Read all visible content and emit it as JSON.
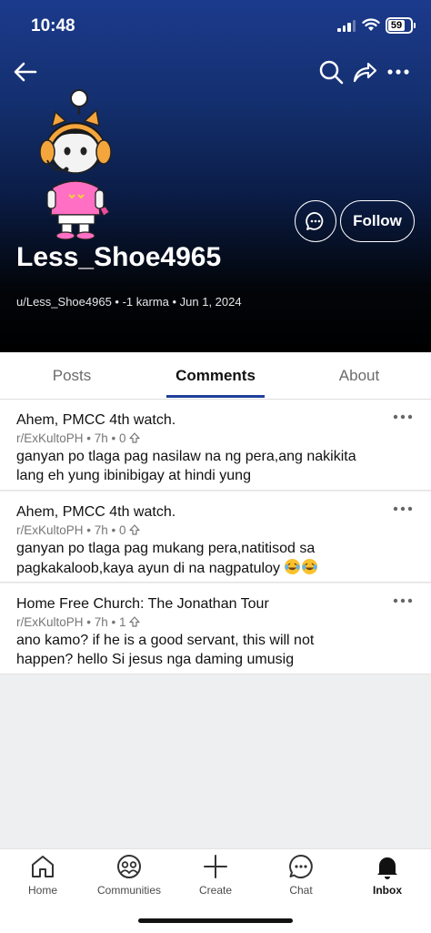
{
  "status": {
    "time": "10:48",
    "battery": "59"
  },
  "icons": {
    "back": "arrow-left-icon",
    "search": "search-icon",
    "share": "share-icon",
    "more": "more-horizontal-icon",
    "chat": "chat-bubble-icon",
    "avatar": "snoo-avatar"
  },
  "profile": {
    "username": "Less_Shoe4965",
    "meta": "u/Less_Shoe4965 • -1 karma • Jun 1, 2024",
    "follow_label": "Follow"
  },
  "tabs": [
    {
      "label": "Posts"
    },
    {
      "label": "Comments"
    },
    {
      "label": "About"
    }
  ],
  "comments": [
    {
      "title": "Ahem, PMCC 4th watch.",
      "meta": "r/ExKultoPH • 7h • 0",
      "body": "ganyan po tlaga pag nasilaw na ng pera,ang nakikita lang eh yung ibinibigay at hindi yung"
    },
    {
      "title": "Ahem, PMCC 4th watch.",
      "meta": "r/ExKultoPH • 7h • 0",
      "body": "ganyan po tlaga pag mukang pera,natitisod sa pagkakaloob,kaya ayun di na nagpatuloy"
    },
    {
      "title": "Home Free Church: The Jonathan Tour",
      "meta": "r/ExKultoPH • 7h • 1",
      "body": "ano kamo? if he is a good servant, this will not happen? hello Si jesus nga daming umusig"
    }
  ],
  "nav": [
    {
      "label": "Home",
      "icon": "home-icon"
    },
    {
      "label": "Communities",
      "icon": "communities-icon"
    },
    {
      "label": "Create",
      "icon": "plus-icon"
    },
    {
      "label": "Chat",
      "icon": "chat-icon"
    },
    {
      "label": "Inbox",
      "icon": "bell-icon"
    }
  ],
  "colors": {
    "accent": "#1f3f9a",
    "header_top": "#1c3a8c",
    "header_bottom": "#000000"
  }
}
